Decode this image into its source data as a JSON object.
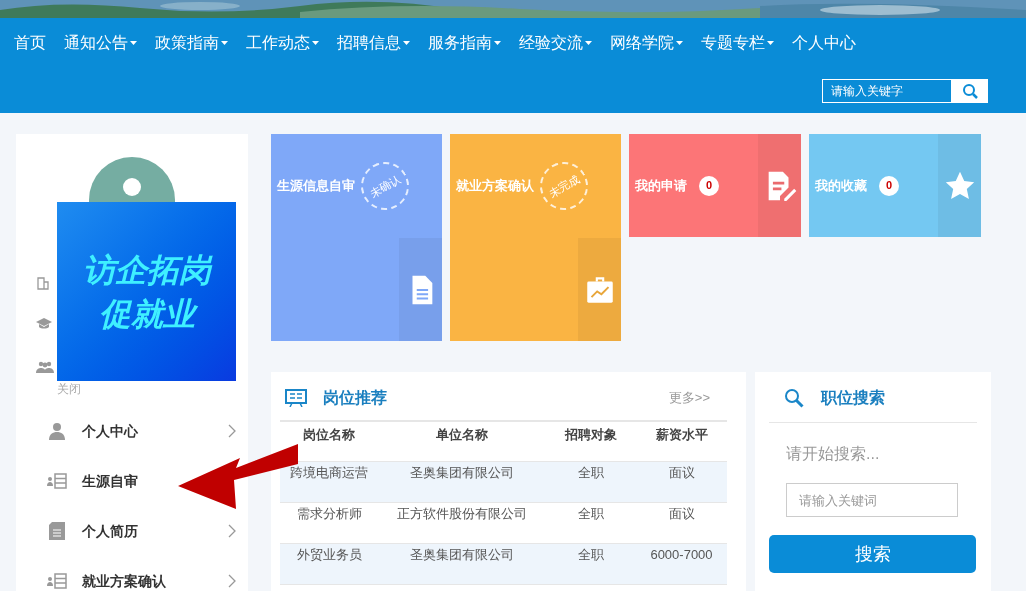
{
  "nav": {
    "items": [
      {
        "label": "首页",
        "dropdown": false
      },
      {
        "label": "通知公告",
        "dropdown": true
      },
      {
        "label": "政策指南",
        "dropdown": true
      },
      {
        "label": "工作动态",
        "dropdown": true
      },
      {
        "label": "招聘信息",
        "dropdown": true
      },
      {
        "label": "服务指南",
        "dropdown": true
      },
      {
        "label": "经验交流",
        "dropdown": true
      },
      {
        "label": "网络学院",
        "dropdown": true
      },
      {
        "label": "专题专栏",
        "dropdown": true
      },
      {
        "label": "个人中心",
        "dropdown": false
      }
    ],
    "search": {
      "placeholder": "请输入关键字"
    }
  },
  "banner": {
    "lines": [
      "访企拓岗",
      "促就业"
    ]
  },
  "sidebar": {
    "close": "关闭",
    "items": [
      {
        "label": "个人中心",
        "chevron": true
      },
      {
        "label": "生源自审",
        "chevron": false
      },
      {
        "label": "个人简历",
        "chevron": true
      },
      {
        "label": "就业方案确认",
        "chevron": true
      }
    ]
  },
  "tiles": [
    {
      "kind": "tall",
      "title": "生源信息自审",
      "stamp": "未确认",
      "color": "#7fa8f8"
    },
    {
      "kind": "tall",
      "title": "就业方案确认",
      "stamp": "未完成",
      "color": "#fab443"
    },
    {
      "kind": "short",
      "title": "我的申请",
      "count": "0",
      "color": "#fc7577"
    },
    {
      "kind": "short",
      "title": "我的收藏",
      "count": "0",
      "color": "#74c8f2"
    }
  ],
  "jobs": {
    "title": "岗位推荐",
    "more": "更多>>",
    "columns": [
      "岗位名称",
      "单位名称",
      "招聘对象",
      "薪资水平"
    ],
    "rows": [
      [
        "跨境电商运营",
        "圣奥集团有限公司",
        "全职",
        "面议"
      ],
      [
        "需求分析师",
        "正方软件股份有限公司",
        "全职",
        "面议"
      ],
      [
        "外贸业务员",
        "圣奥集团有限公司",
        "全职",
        "6000-7000"
      ]
    ]
  },
  "job_search": {
    "title": "职位搜索",
    "hint": "请开始搜索...",
    "placeholder": "请输入关键词",
    "button": "搜索"
  }
}
